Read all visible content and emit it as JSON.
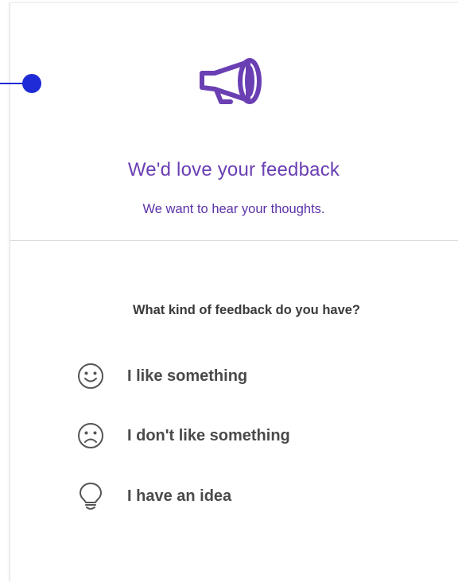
{
  "header": {
    "icon": "megaphone-icon",
    "title": "We'd love your feedback",
    "subtitle": "We want to hear your thoughts."
  },
  "question": "What kind of feedback do you have?",
  "options": [
    {
      "label": "I like something",
      "icon": "smile-face-icon"
    },
    {
      "label": "I don't like something",
      "icon": "frown-face-icon"
    },
    {
      "label": "I have an idea",
      "icon": "lightbulb-icon"
    }
  ],
  "colors": {
    "accent": "#6a3fb3",
    "pointer": "#1e2bd6",
    "text": "#4a4a4a"
  }
}
